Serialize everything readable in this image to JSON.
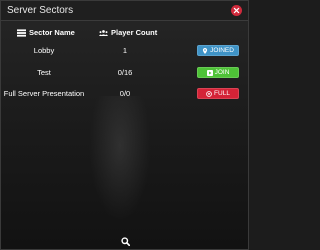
{
  "window": {
    "title": "Server Sectors",
    "close_icon": "close-circle-icon",
    "accent_close": "#d02a3c"
  },
  "table": {
    "headers": {
      "sector_name": "Sector Name",
      "sector_icon": "list-icon",
      "player_count": "Player Count",
      "player_icon": "users-icon"
    },
    "rows": [
      {
        "name": "Lobby",
        "count": "1",
        "action": "JOINED",
        "action_icon": "map-marker-icon",
        "status": "joined",
        "color": "#3f93c6"
      },
      {
        "name": "Test",
        "count": "0/16",
        "action": "JOIN",
        "action_icon": "play-icon",
        "status": "join",
        "color": "#4ec237"
      },
      {
        "name": "Full Server Presentation",
        "count": "0/0",
        "action": "FULL",
        "action_icon": "x-circle-icon",
        "status": "full",
        "color": "#d42337"
      }
    ]
  },
  "footer": {
    "search_icon": "search-icon"
  }
}
